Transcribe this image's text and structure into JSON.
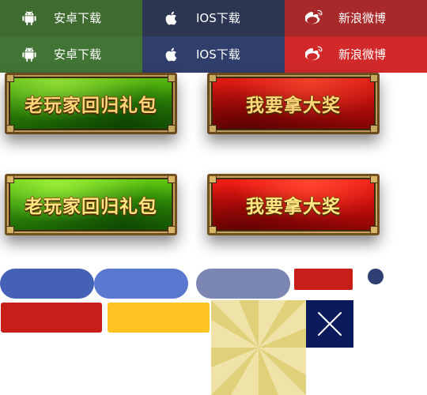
{
  "downloads": {
    "row1": {
      "android": "安卓下载",
      "ios": "IOS下载",
      "weibo": "新浪微博"
    },
    "row2": {
      "android": "安卓下载",
      "ios": "IOS下载",
      "weibo": "新浪微博"
    },
    "icons": [
      "android-icon",
      "apple-icon",
      "weibo-icon"
    ]
  },
  "rewards": {
    "veteran_label": "老玩家回归礼包",
    "prize_label": "我要拿大奖"
  },
  "colors": {
    "android_row1": "#3f6b30",
    "android_row2": "#427535",
    "ios_row1": "#2c3552",
    "ios_row2": "#2f3e6b",
    "weibo_row1": "#a8292a",
    "weibo_row2": "#d1282a",
    "pill_blue_dark": "#4461b6",
    "pill_blue_light": "#5b78d1",
    "pill_gray_blue": "#7b86b2",
    "red_small": "#c81e1a",
    "dot_navy": "#2e3d72",
    "red_large": "#c81e1a",
    "yellow": "#fdc321",
    "sunburst_base": "#ecde98",
    "close_bg": "#0b1a5c"
  }
}
